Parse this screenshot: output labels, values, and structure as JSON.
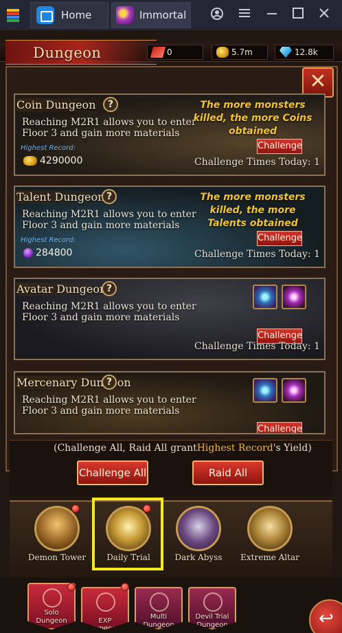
{
  "window": {
    "tabs": [
      {
        "label": "Home",
        "icon": "home-icon"
      },
      {
        "label": "Immortal",
        "icon": "game-icon"
      }
    ],
    "controls": [
      "account-icon",
      "menu-icon",
      "minimize-icon",
      "maximize-icon",
      "close-icon"
    ]
  },
  "header": {
    "title": "Dungeon",
    "stamina": "0",
    "coins": "5.7m",
    "gems": "12.8k"
  },
  "dungeons": [
    {
      "title": "Coin Dungeon",
      "desc": "Reaching M2R1 allows you to enter Floor 3 and gain more materials",
      "promo": "The more monsters killed, the more Coins obtained",
      "highest_label": "Highest Record:",
      "highest_value": "4290000",
      "button": "Challenge",
      "times": "Challenge Times Today:  1"
    },
    {
      "title": "Talent Dungeon",
      "desc": "Reaching M2R1 allows you to enter Floor 3 and gain more materials",
      "promo": "The more monsters killed, the more Talents obtained",
      "highest_label": "Highest Record:",
      "highest_value": "284800",
      "button": "Challenge",
      "times": "Challenge Times Today:  1"
    },
    {
      "title": "Avatar Dungeon",
      "desc": "Reaching M2R1 allows you to enter Floor 3 and gain more materials",
      "button": "Challenge",
      "times": "Challenge Times Today:  1"
    },
    {
      "title": "Mercenary Dungeon",
      "desc": "Reaching M2R1 allows you to enter Floor 3 and gain more materials",
      "button": "Challenge"
    }
  ],
  "actions": {
    "grant_prefix": "(Challenge All, Raid All grant",
    "grant_highlight": "Highest Record",
    "grant_suffix": "'s Yield)",
    "challenge_all": "Challenge All",
    "raid_all": "Raid All"
  },
  "modes": [
    {
      "label": "Demon Tower"
    },
    {
      "label": "Daily Trial"
    },
    {
      "label": "Dark Abyss"
    },
    {
      "label": "Extreme Altar"
    }
  ],
  "bottom_tabs": [
    {
      "label_top": "Solo",
      "label": "Dungeon"
    },
    {
      "label_top": "",
      "label": "EXP Dungeon"
    },
    {
      "label_top": "Multi",
      "label": "Dungeon"
    },
    {
      "label_top": "Devil Trial",
      "label": "Dungeon"
    }
  ]
}
